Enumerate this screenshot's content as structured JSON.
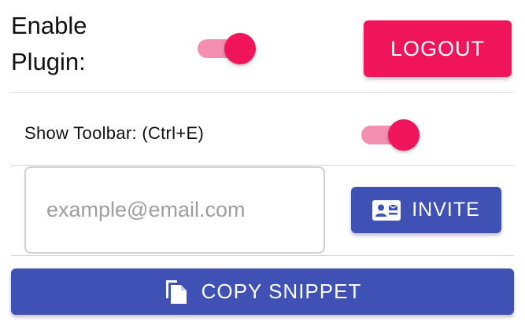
{
  "plugin": {
    "label": "Enable Plugin:",
    "enabled": true
  },
  "toolbar": {
    "label": "Show Toolbar: (Ctrl+E)",
    "enabled": true
  },
  "buttons": {
    "logout_label": "LOGOUT",
    "invite_label": "INVITE",
    "copy_snippet_label": "COPY SNIPPET"
  },
  "invite": {
    "email_placeholder": "example@email.com",
    "email_value": ""
  },
  "icons": {
    "invite": "contact-card-icon",
    "copy": "copy-icon"
  },
  "colors": {
    "accent_pink": "#f0145a",
    "toggle_track": "#f48fb1",
    "primary_indigo": "#3f51b5"
  }
}
